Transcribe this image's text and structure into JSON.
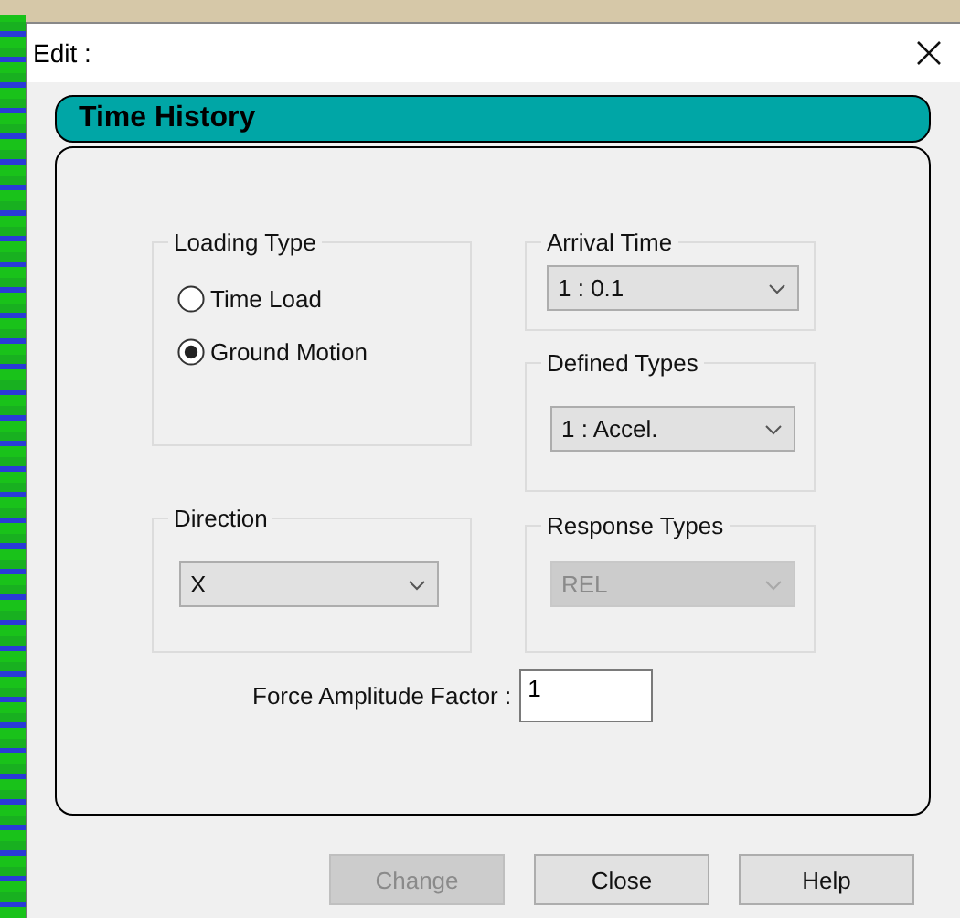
{
  "window": {
    "title": "Edit :"
  },
  "header": "Time History",
  "loading_type": {
    "label": "Loading Type",
    "options": [
      {
        "label": "Time Load",
        "selected": false
      },
      {
        "label": "Ground Motion",
        "selected": true
      }
    ]
  },
  "arrival_time": {
    "label": "Arrival Time",
    "value": "1 : 0.1",
    "disabled": false
  },
  "defined_types": {
    "label": "Defined Types",
    "value": "1 : Accel.",
    "disabled": false
  },
  "direction": {
    "label": "Direction",
    "value": "X",
    "disabled": false
  },
  "response_types": {
    "label": "Response Types",
    "value": "REL",
    "disabled": true
  },
  "force_amplitude": {
    "label": "Force Amplitude Factor :",
    "value": "1"
  },
  "buttons": [
    {
      "label": "Change",
      "disabled": true
    },
    {
      "label": "Close",
      "disabled": false
    },
    {
      "label": "Help",
      "disabled": false
    }
  ]
}
